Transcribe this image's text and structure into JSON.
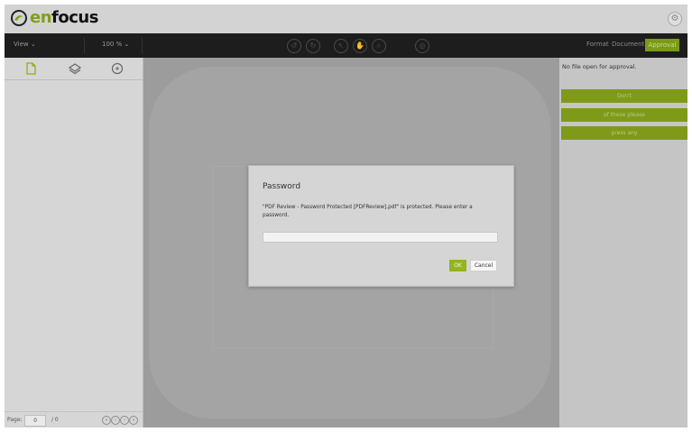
{
  "header": {
    "brand": {
      "prefix": "en",
      "suffix": "focus"
    },
    "settings_icon": "gear-icon"
  },
  "toolbar": {
    "view_label": "View",
    "zoom_label": "100 %",
    "tools": [
      "rotate-left-icon",
      "rotate-right-icon",
      "select-icon",
      "hand-icon",
      "zoom-icon",
      "measure-icon"
    ],
    "tabs": {
      "format": "Format",
      "document": "Document",
      "approval": "Approval"
    },
    "accent_color": "#7c9a16"
  },
  "left_panel": {
    "tabs": [
      "page-thumbnail-icon",
      "layers-icon",
      "annotations-icon"
    ],
    "footer": {
      "page_label": "Page:",
      "page_value": "0",
      "page_total": "/ 0"
    }
  },
  "right_panel": {
    "message": "No file open for approval.",
    "buttons": [
      "Don't",
      "of these please",
      "press any"
    ]
  },
  "dialog": {
    "title": "Password",
    "message": "\"PDF Review - Password Protected [PDFReview].pdf\" is protected. Please enter a password.",
    "password_value": "",
    "ok_label": "OK",
    "cancel_label": "Cancel"
  }
}
